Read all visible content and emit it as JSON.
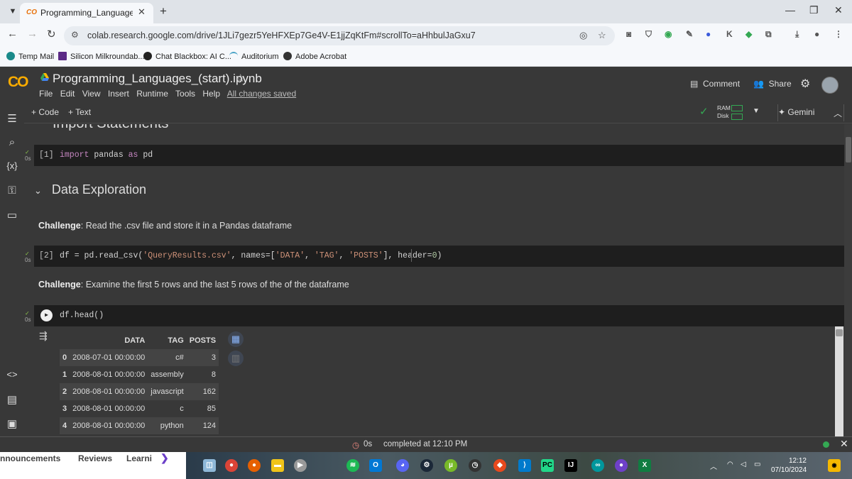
{
  "browser": {
    "tab_title": "Programming_Languages_(start",
    "favicon": "CO",
    "url": "colab.research.google.com/drive/1JLi7gezr5YeHFXEp7Ge4V-E1jjZqKtFm#scrollTo=aHhbulJaGxu7",
    "extension_k": "K"
  },
  "bookmarks": [
    "Temp Mail",
    "Silicon Milkroundab...",
    "Chat Blackbox: AI C...",
    "Auditorium",
    "Adobe Acrobat"
  ],
  "colab": {
    "logo": "CO",
    "notebook_title": "Programming_Languages_(start).ipynb",
    "menu": [
      "File",
      "Edit",
      "View",
      "Insert",
      "Runtime",
      "Tools",
      "Help"
    ],
    "saved_status": "All changes saved",
    "comment": "Comment",
    "share": "Share",
    "add_code": "+ Code",
    "add_text": "+ Text",
    "ram": "RAM",
    "disk": "Disk",
    "gemini": "✦ Gemini"
  },
  "cells": {
    "clipped_heading": "Import Statements",
    "cell1": {
      "prompt": "[1]",
      "time": "0s"
    },
    "section_title": "Data Exploration",
    "challenge_label": "Challenge",
    "md1": ": Read the .csv file and store it in a Pandas dataframe",
    "cell2": {
      "prompt": "[2]",
      "time": "0s"
    },
    "md2": ": Examine the first 5 rows and the last 5 rows of the of the dataframe",
    "cell3": {
      "time": "0s"
    }
  },
  "output": {
    "columns": [
      "",
      "DATA",
      "TAG",
      "POSTS"
    ],
    "rows": [
      [
        "0",
        "2008-07-01 00:00:00",
        "c#",
        "3"
      ],
      [
        "1",
        "2008-08-01 00:00:00",
        "assembly",
        "8"
      ],
      [
        "2",
        "2008-08-01 00:00:00",
        "javascript",
        "162"
      ],
      [
        "3",
        "2008-08-01 00:00:00",
        "c",
        "85"
      ],
      [
        "4",
        "2008-08-01 00:00:00",
        "python",
        "124"
      ]
    ]
  },
  "status": {
    "time": "0s",
    "text": "completed at 12:10 PM"
  },
  "background_page": [
    "nnouncements",
    "Reviews",
    "Learni"
  ],
  "taskbar": {
    "time": "12:12",
    "date": "07/10/2024"
  },
  "icons": [
    "chevron-down-icon",
    "close-icon",
    "plus-icon",
    "back-icon",
    "forward-icon",
    "reload-icon",
    "site-settings-icon",
    "eye-off-icon",
    "star-icon",
    "toc-icon",
    "search-icon",
    "variables-icon",
    "key-icon",
    "folder-icon",
    "code-icon",
    "terminal-icon",
    "play-icon",
    "table-icon",
    "chart-icon",
    "settings-icon",
    "comment-icon",
    "share-icon"
  ]
}
